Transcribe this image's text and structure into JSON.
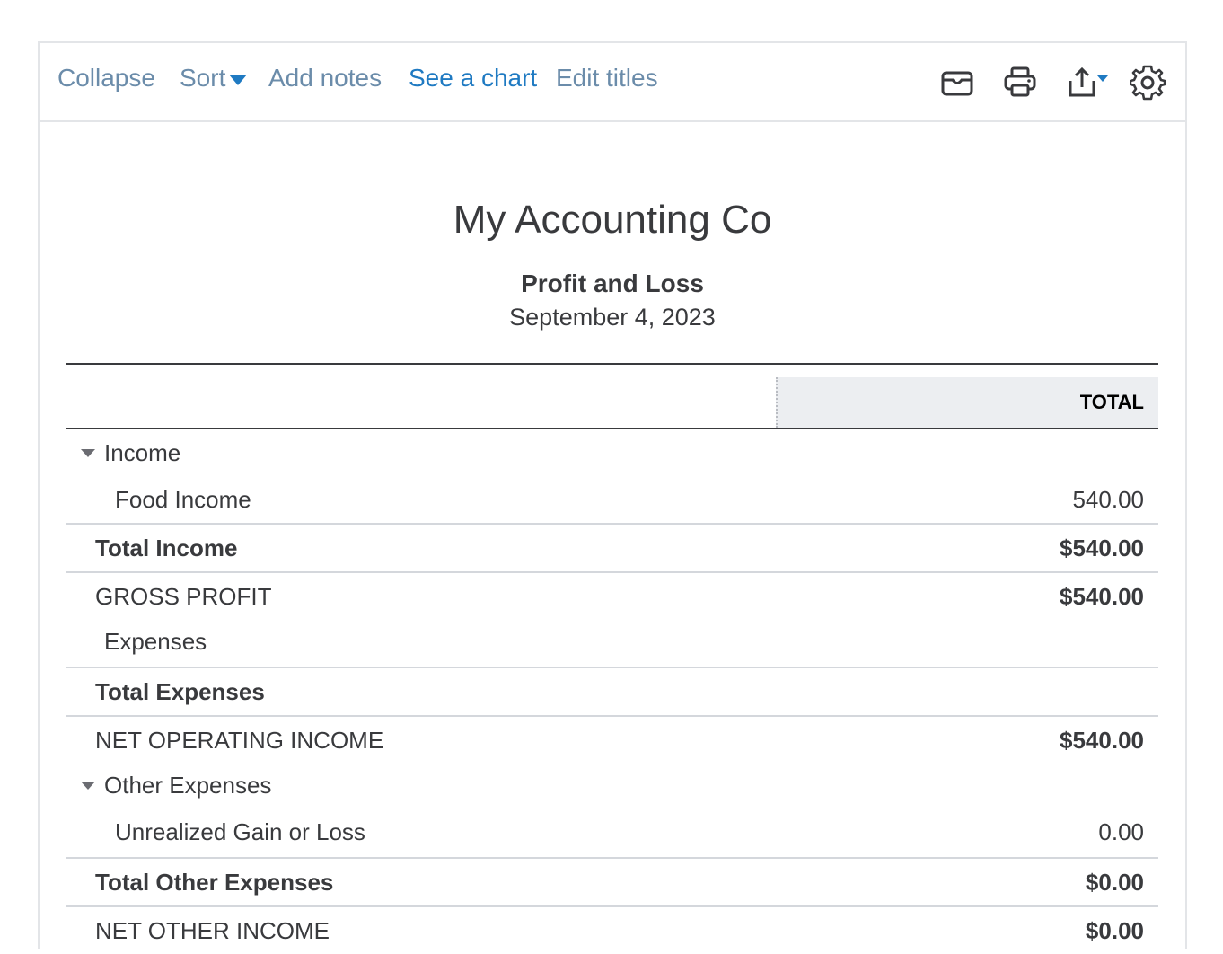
{
  "toolbar": {
    "collapse": "Collapse",
    "sort": "Sort",
    "add_notes": "Add notes",
    "see_chart": "See a chart",
    "edit_titles": "Edit titles",
    "icons": [
      "email-icon",
      "print-icon",
      "export-icon",
      "settings-icon"
    ]
  },
  "report": {
    "company": "My Accounting Co",
    "title": "Profit and Loss",
    "date": "September 4, 2023",
    "column_header": "TOTAL"
  },
  "rows": [
    {
      "label": "Income",
      "amount": ""
    },
    {
      "label": "Food Income",
      "amount": "540.00"
    },
    {
      "label": "Total Income",
      "amount": "$540.00"
    },
    {
      "label": "GROSS PROFIT",
      "amount": "$540.00"
    },
    {
      "label": "Expenses",
      "amount": ""
    },
    {
      "label": "Total Expenses",
      "amount": ""
    },
    {
      "label": "NET OPERATING INCOME",
      "amount": "$540.00"
    },
    {
      "label": "Other Expenses",
      "amount": ""
    },
    {
      "label": "Unrealized Gain or Loss",
      "amount": "0.00"
    },
    {
      "label": "Total Other Expenses",
      "amount": "$0.00"
    },
    {
      "label": "NET OTHER INCOME",
      "amount": "$0.00"
    }
  ],
  "colors": {
    "link": "#6b8caa",
    "link_active": "#1f7ac2",
    "text": "#393a3d",
    "header_bg": "#eceef1"
  }
}
